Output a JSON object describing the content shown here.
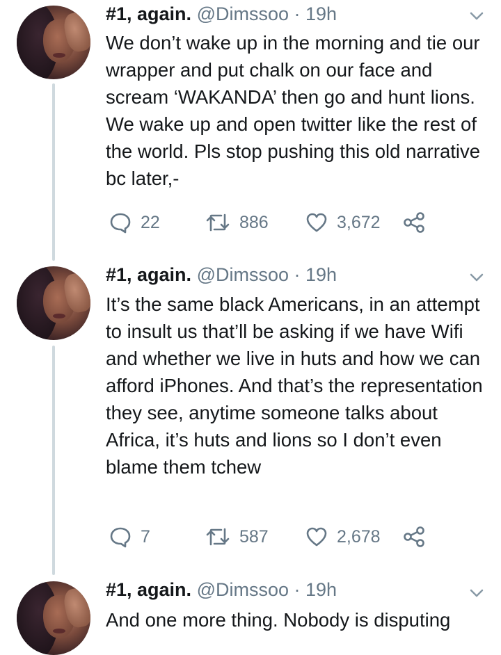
{
  "tweets": [
    {
      "name": "#1, again.",
      "handle": "@Dimssoo",
      "time": "· 19h",
      "text": "We don’t wake up in the morning and tie our wrapper and put chalk on our face and scream ‘WAKANDA’ then go and hunt lions. We wake up and open twitter like the rest of the world. Pls stop pushing this old narrative bc later,-",
      "replies": "22",
      "retweets": "886",
      "likes": "3,672"
    },
    {
      "name": "#1, again.",
      "handle": "@Dimssoo",
      "time": "· 19h",
      "text": "It’s the same black Americans, in an attempt to insult us that’ll be asking if we have Wifi and whether we live in huts and how we can afford iPhones. And that’s the representation they see, anytime someone talks about Africa, it’s huts and lions so I don’t even blame them tchew",
      "replies": "7",
      "retweets": "587",
      "likes": "2,678"
    },
    {
      "name": "#1, again.",
      "handle": "@Dimssoo",
      "time": "· 19h",
      "text": "And one more thing. Nobody is disputing"
    }
  ],
  "icons": {
    "reply": "reply-icon",
    "retweet": "retweet-icon",
    "like": "heart-icon",
    "share": "share-icon",
    "menu": "chevron-down-icon"
  },
  "colors": {
    "text": "#14171a",
    "muted": "#657786",
    "thread_line": "#cfd9de"
  }
}
